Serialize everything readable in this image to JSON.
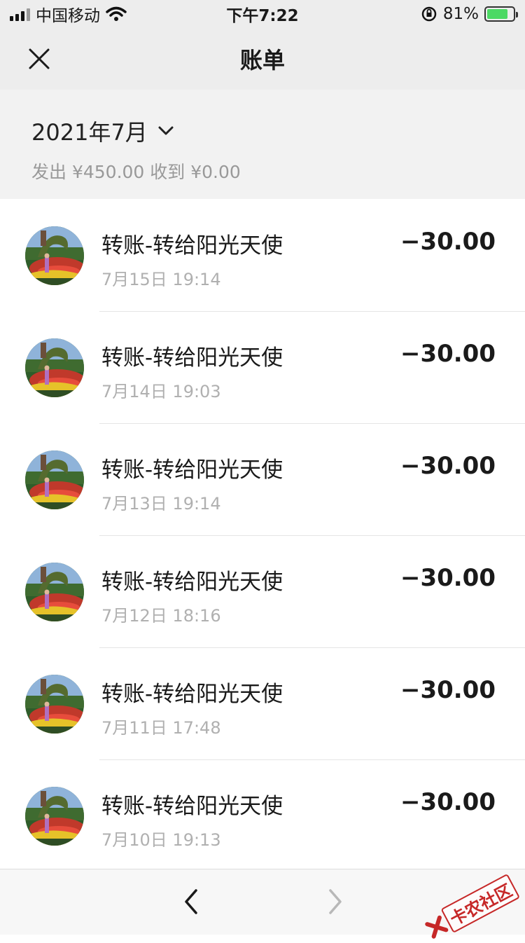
{
  "status_bar": {
    "carrier": "中国移动",
    "time": "下午7:22",
    "battery_percent": "81%",
    "battery_level": 0.81
  },
  "header": {
    "title": "账单"
  },
  "summary": {
    "month": "2021年7月",
    "totals": "发出 ¥450.00 收到 ¥0.00"
  },
  "transactions": [
    {
      "title": "转账-转给阳光天使",
      "time": "7月15日 19:14",
      "amount": "−30.00"
    },
    {
      "title": "转账-转给阳光天使",
      "time": "7月14日 19:03",
      "amount": "−30.00"
    },
    {
      "title": "转账-转给阳光天使",
      "time": "7月13日 19:14",
      "amount": "−30.00"
    },
    {
      "title": "转账-转给阳光天使",
      "time": "7月12日 18:16",
      "amount": "−30.00"
    },
    {
      "title": "转账-转给阳光天使",
      "time": "7月11日 17:48",
      "amount": "−30.00"
    },
    {
      "title": "转账-转给阳光天使",
      "time": "7月10日 19:13",
      "amount": "−30.00"
    }
  ],
  "watermark": {
    "text": "卡农社区"
  },
  "icons": {
    "close": "close-icon",
    "dropdown": "chevron-down-icon",
    "back": "chevron-left-icon",
    "forward": "chevron-right-icon"
  },
  "colors": {
    "header_bg": "#ededed",
    "summary_bg": "#f2f2f2",
    "muted_text": "#b0b0b0",
    "watermark": "#c62828"
  }
}
